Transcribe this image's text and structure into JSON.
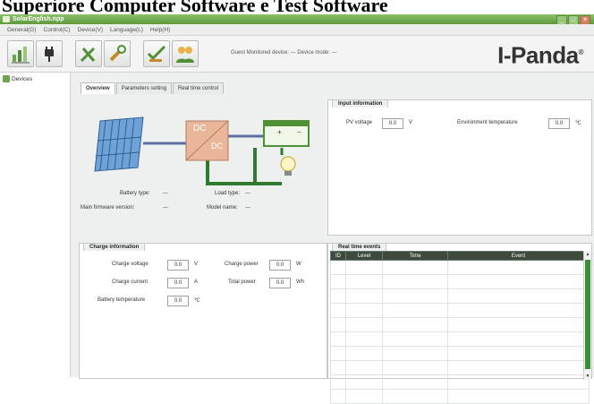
{
  "banner": {
    "text": "Superiore Computer Software e Test Software"
  },
  "window": {
    "title": "SolarEnglish.npp",
    "minimize": "_",
    "maximize": "□",
    "close": "✕"
  },
  "menu": [
    "General(G)",
    "Control(C)",
    "Device(V)",
    "Language(L)",
    "Help(H)"
  ],
  "toolbar": {
    "buttons": [
      "chart-icon",
      "plug-icon",
      "tools-icon",
      "wrench-icon",
      "checklist-icon",
      "users-icon"
    ],
    "status_text": "Guest   Monitored device: ---   Device mode: ---"
  },
  "logo": {
    "text": "I-Panda",
    "mark": "®"
  },
  "sidebar": {
    "root_label": "Devices"
  },
  "tabs": [
    "Overview",
    "Parameters setting",
    "Real time control"
  ],
  "overview": {
    "dc_top": "DC",
    "dc_bottom": "DC",
    "battery_plus": "+",
    "battery_minus": "−",
    "battery_type_label": "Battery type:",
    "battery_type_value": "---",
    "load_type_label": "Load type:",
    "load_type_value": "---",
    "firmware_label": "Main firmware version:",
    "firmware_value": "---",
    "model_label": "Model name:",
    "model_value": "---"
  },
  "input_info": {
    "title": "Input information",
    "pv_voltage_label": "PV voltage",
    "pv_voltage_value": "0.0",
    "pv_voltage_unit": "V",
    "env_temp_label": "Environment temperature",
    "env_temp_value": "0.0",
    "env_temp_unit": "℃"
  },
  "charge_info": {
    "title": "Charge information",
    "charge_voltage_label": "Charge voltage",
    "charge_voltage_value": "0.0",
    "charge_voltage_unit": "V",
    "charge_power_label": "Charge power",
    "charge_power_value": "0.0",
    "charge_power_unit": "W",
    "charge_current_label": "Charge current",
    "charge_current_value": "0.0",
    "charge_current_unit": "A",
    "total_power_label": "Total power",
    "total_power_value": "0.0",
    "total_power_unit": "Wh",
    "battery_temp_label": "Battery temperature",
    "battery_temp_value": "0.0",
    "battery_temp_unit": "℃"
  },
  "events": {
    "title": "Real time events",
    "columns": [
      "ID",
      "Level",
      "Time",
      "Event"
    ]
  },
  "colors": {
    "title_bar": "#5e9a3e",
    "accent_green": "#3b8f3b",
    "dc_box": "#e9b69a"
  }
}
